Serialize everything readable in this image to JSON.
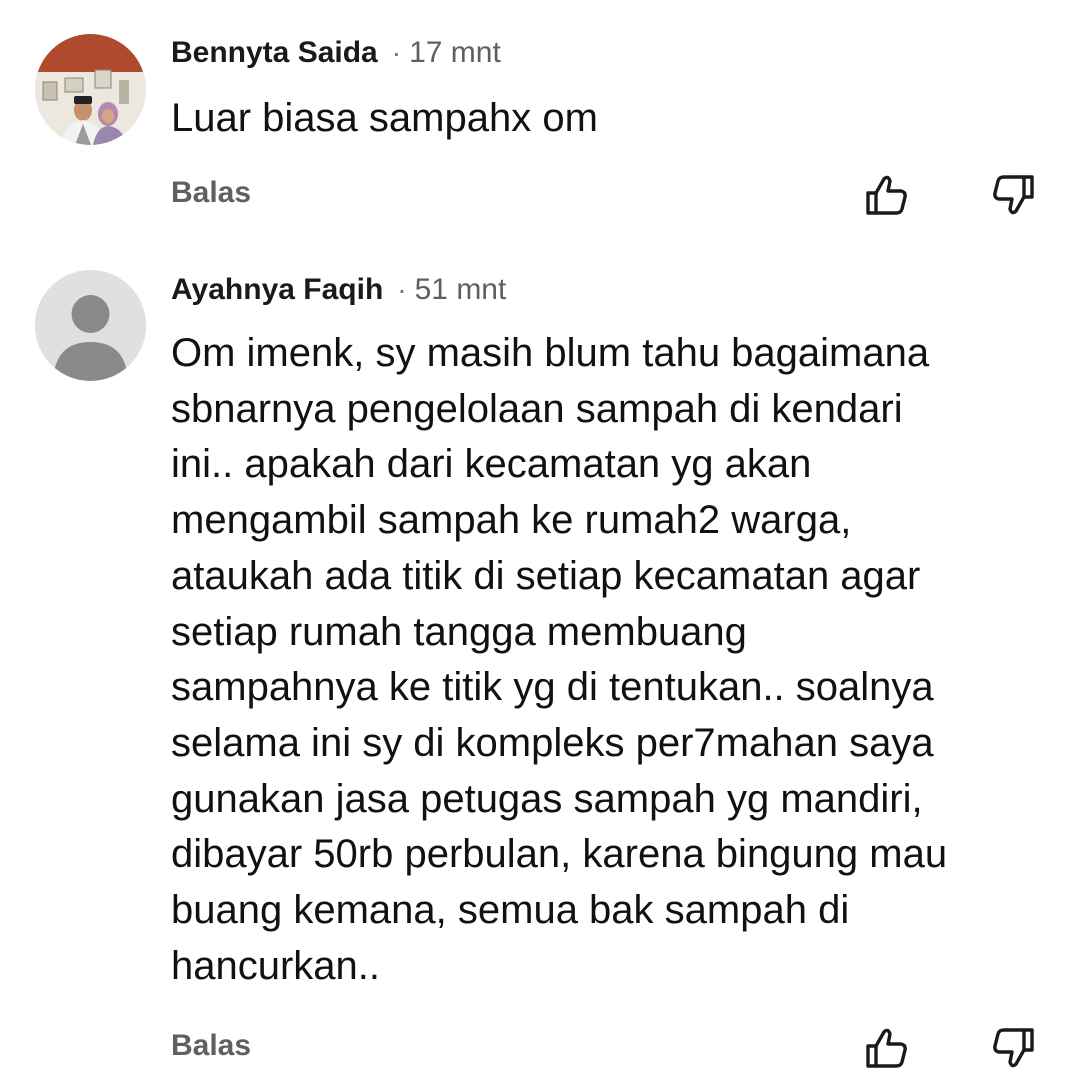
{
  "comments": [
    {
      "author": "Bennyta Saida",
      "separator": "·",
      "time": "17 mnt",
      "text": "Luar biasa sampahx om",
      "reply_label": "Balas",
      "avatar_icon": "user-photo-avatar",
      "like_icon": "thumbs-up-icon",
      "dislike_icon": "thumbs-down-icon"
    },
    {
      "author": "Ayahnya Faqih",
      "separator": "·",
      "time": "51 mnt",
      "text": "Om imenk, sy masih blum tahu bagaimana\nsbnarnya pengelolaan sampah di kendari\nini.. apakah dari kecamatan yg akan\nmengambil sampah ke rumah2 warga,\nataukah ada titik di setiap kecamatan agar\nsetiap rumah tangga membuang\nsampahnya ke titik yg di tentukan.. soalnya\nselama ini sy di kompleks per7mahan saya\ngunakan jasa petugas sampah yg mandiri,\ndibayar 50rb perbulan, karena bingung mau\nbuang kemana, semua bak sampah di\nhancurkan..",
      "reply_label": "Balas",
      "avatar_icon": "default-person-avatar",
      "like_icon": "thumbs-up-icon",
      "dislike_icon": "thumbs-down-icon"
    }
  ],
  "colors": {
    "text": "#111111",
    "secondary": "#606060",
    "icon": "#1a1a1a",
    "default_avatar_bg": "#e0e0e0",
    "default_avatar_fg": "#8a8a8a"
  }
}
